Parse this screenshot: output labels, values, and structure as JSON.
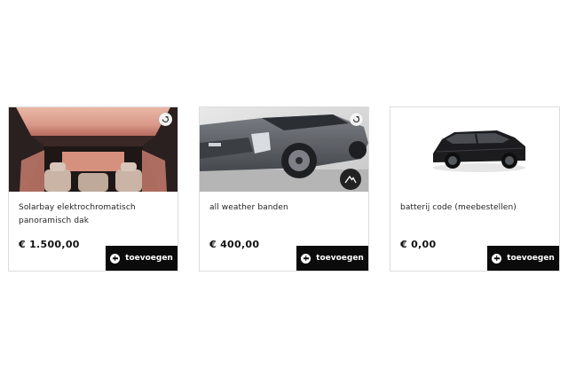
{
  "cards": [
    {
      "title": "Solarbay elektrochromatisch panoramisch dak",
      "price": "€ 1.500,00",
      "button_label": "toevoegen",
      "image": "panoramic-roof-interior",
      "badge_icon": "accessory-badge-icon"
    },
    {
      "title": "all weather banden",
      "price": "€ 400,00",
      "button_label": "toevoegen",
      "image": "grey-suv-front",
      "badge_icon": "accessory-badge-icon",
      "secondary_icon": "mountain-icon"
    },
    {
      "title": "batterij code (meebestellen)",
      "price": "€ 0,00",
      "button_label": "toevoegen",
      "image": "black-suv-side"
    }
  ],
  "colors": {
    "button_bg": "#0b0b0b",
    "button_text": "#ffffff",
    "card_border": "#dcdcdc"
  }
}
